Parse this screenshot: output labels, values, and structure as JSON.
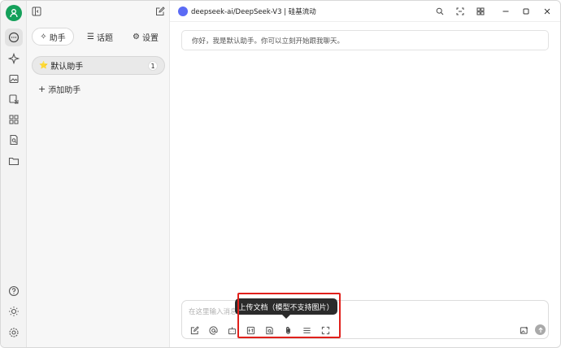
{
  "rail": {
    "avatar_icon": "user-avatar-icon",
    "top_items": [
      "chat-icon",
      "sparkle-icon",
      "image-icon",
      "translate-icon",
      "apps-icon",
      "file-search-icon",
      "folder-icon"
    ],
    "bottom_items": [
      "help-icon",
      "theme-icon",
      "settings-icon"
    ],
    "accent": "#14a05a"
  },
  "panel": {
    "tabs": [
      {
        "label": "助手",
        "icon": "sparkle-icon"
      },
      {
        "label": "话题",
        "icon": "list-icon"
      },
      {
        "label": "设置",
        "icon": "gear-icon"
      }
    ],
    "active_assistant": {
      "emoji": "⭐",
      "name": "默认助手",
      "count": "1"
    },
    "add_assistant_label": "添加助手"
  },
  "titlebar": {
    "model_title": "deepseek-ai/DeepSeek-V3 | 硅基流动"
  },
  "chat": {
    "greeting": "你好，我是默认助手。你可以立刻开始跟我聊天。"
  },
  "composer": {
    "placeholder": "在这里输入消息...",
    "tooltip": "上传文档（模型不支持图片）"
  },
  "colors": {
    "highlight": "#e0201b",
    "tooltip_bg": "#2b2b2b"
  }
}
